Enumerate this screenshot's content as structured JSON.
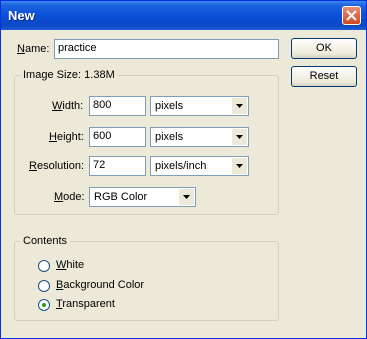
{
  "window": {
    "title": "New"
  },
  "name": {
    "label": "Name:",
    "value": "practice"
  },
  "buttons": {
    "ok": "OK",
    "reset": "Reset"
  },
  "image_size": {
    "label": "Image Size:",
    "value": "1.38M",
    "width": {
      "label": "Width:",
      "value": "800",
      "unit": "pixels"
    },
    "height": {
      "label": "Height:",
      "value": "600",
      "unit": "pixels"
    },
    "resolution": {
      "label": "Resolution:",
      "value": "72",
      "unit": "pixels/inch"
    },
    "mode": {
      "label": "Mode:",
      "value": "RGB Color"
    }
  },
  "contents": {
    "label": "Contents",
    "options": [
      {
        "label": "White",
        "checked": false
      },
      {
        "label": "Background Color",
        "checked": false
      },
      {
        "label": "Transparent",
        "checked": true
      }
    ]
  }
}
